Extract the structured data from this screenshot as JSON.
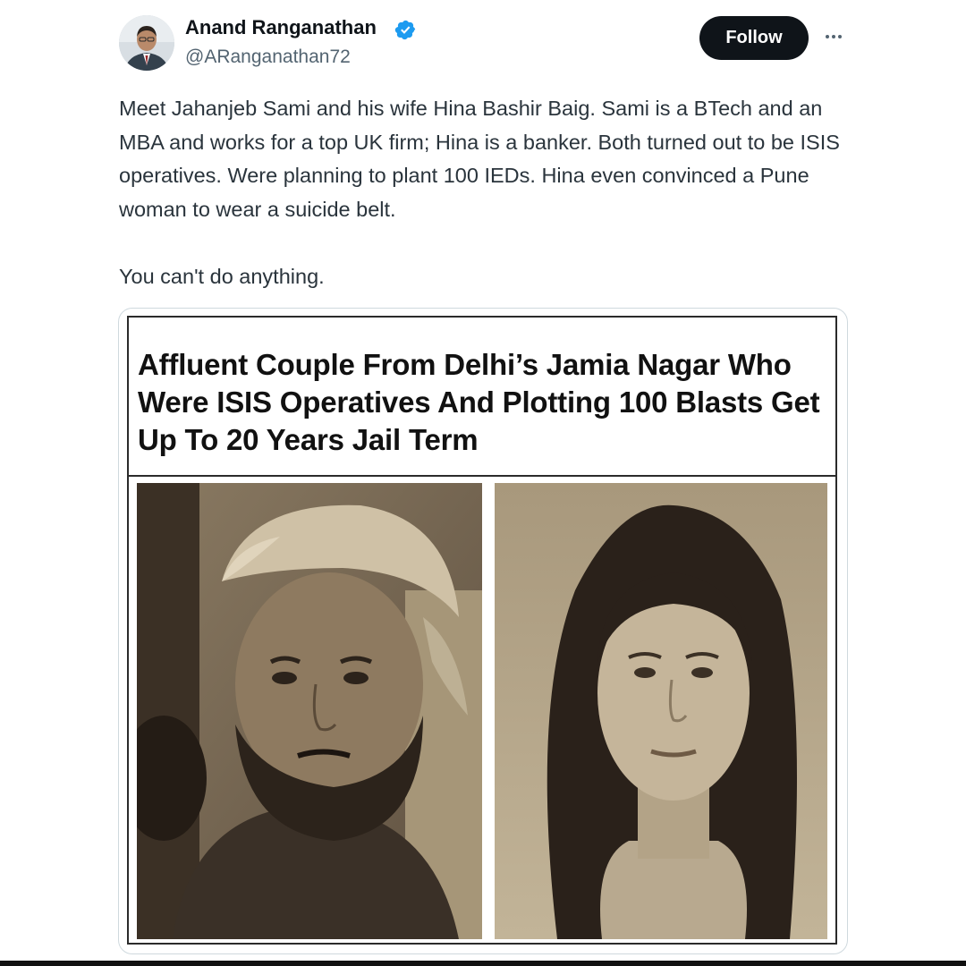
{
  "tweet": {
    "author": {
      "name": "Anand Ranganathan",
      "handle": "@ARanganathan72",
      "verified": true,
      "avatar_icon": "avatar"
    },
    "follow_label": "Follow",
    "more_icon": "more-options-icon",
    "text": {
      "paragraph_1": "Meet Jahanjeb Sami and his wife Hina Bashir Baig. Sami is a BTech and an MBA and works for a top UK firm; Hina is a banker. Both turned out to be ISIS operatives. Were planning to plant 100 IEDs. Hina even convinced a Pune woman to wear a suicide belt.",
      "paragraph_2": "You can't do anything."
    },
    "media": {
      "headline": "Affluent Couple From Delhi’s Jamia Nagar Who Were ISIS Operatives And Plotting 100 Blasts Get Up To 20 Years Jail Term",
      "photos": [
        "man-in-cap-photo",
        "woman-portrait-photo"
      ]
    }
  },
  "colors": {
    "text_primary": "#0f1419",
    "text_secondary": "#536471",
    "verified_blue": "#1d9bf0",
    "follow_bg": "#0f1419",
    "follow_text": "#ffffff",
    "sepia_dark": "#3b3025",
    "sepia_light": "#b8a98f"
  }
}
